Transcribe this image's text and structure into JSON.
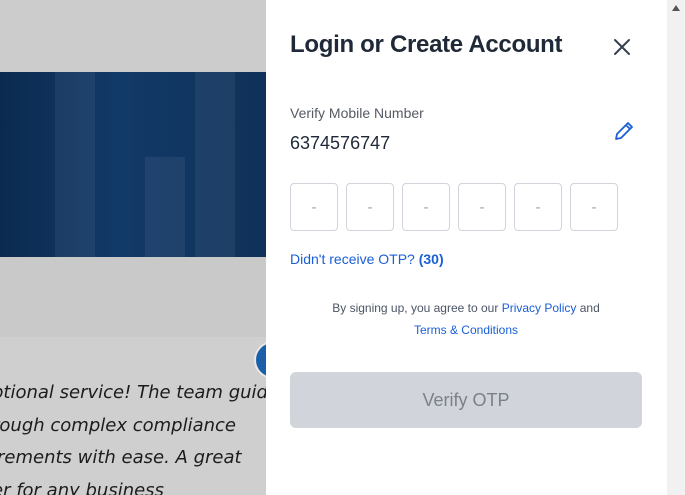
{
  "background": {
    "quote_lines": [
      "ptional service! The team guided",
      "rough complex compliance",
      "irements with ease. A great",
      "er for any business"
    ]
  },
  "drawer": {
    "title": "Login or Create Account",
    "verify_label": "Verify Mobile Number",
    "phone_number": "6374576747",
    "otp_placeholders": [
      "-",
      "-",
      "-",
      "-",
      "-",
      "-"
    ],
    "resend_text": "Didn't receive OTP?",
    "resend_timer": "(30)",
    "terms_prefix": "By signing up, you agree to our",
    "privacy_link": "Privacy Policy",
    "terms_and": "and",
    "terms_link": "Terms & Conditions",
    "verify_button": "Verify OTP"
  },
  "colors": {
    "accent": "#1a5fd6",
    "disabled_button": "#d1d5db",
    "title": "#1f2937"
  },
  "icons": {
    "close": "close-icon",
    "edit": "pencil-icon",
    "scroll_up": "scroll-up-arrow"
  }
}
